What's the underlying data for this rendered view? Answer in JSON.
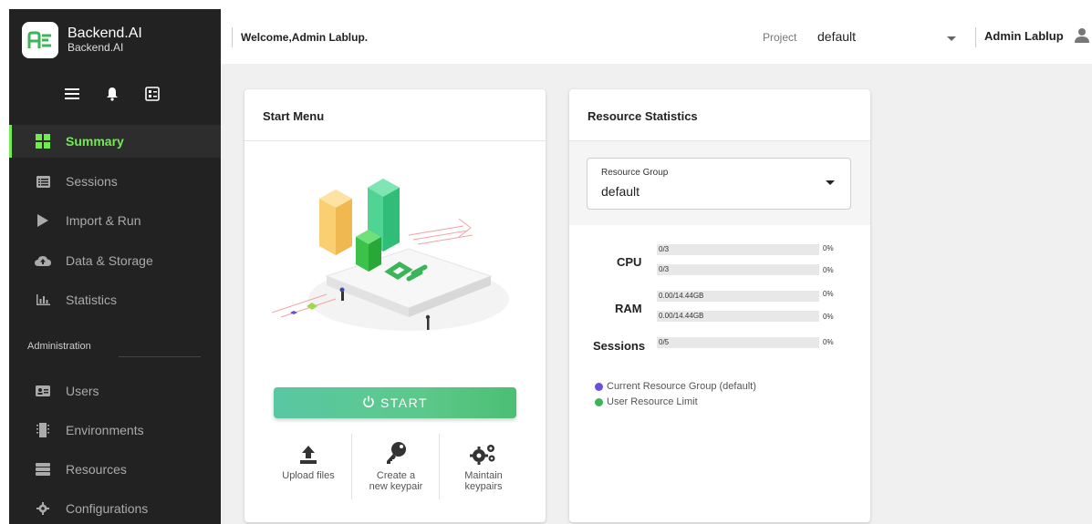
{
  "brand": {
    "title": "Backend.AI",
    "subtitle": "Backend.AI",
    "accent": "#72eb51"
  },
  "toolbar": {
    "icons": [
      "menu-icon",
      "bell-icon",
      "dashboard-icon"
    ]
  },
  "sidebar": {
    "items": [
      {
        "label": "Summary",
        "icon": "summary-grid-icon",
        "active": true
      },
      {
        "label": "Sessions",
        "icon": "sessions-list-icon"
      },
      {
        "label": "Import & Run",
        "icon": "play-icon"
      },
      {
        "label": "Data & Storage",
        "icon": "cloud-upload-icon"
      },
      {
        "label": "Statistics",
        "icon": "bar-chart-icon"
      }
    ],
    "admin_label": "Administration",
    "admin_items": [
      {
        "label": "Users",
        "icon": "id-card-icon"
      },
      {
        "label": "Environments",
        "icon": "chip-icon"
      },
      {
        "label": "Resources",
        "icon": "server-icon"
      },
      {
        "label": "Configurations",
        "icon": "gear-icon"
      }
    ]
  },
  "header": {
    "welcome": "Welcome,Admin Lablup.",
    "project_label": "Project",
    "project_value": "default",
    "user_name": "Admin Lablup"
  },
  "start_menu": {
    "title": "Start Menu",
    "start_label": "START",
    "actions": [
      {
        "line1": "Upload files",
        "line2": "",
        "icon": "upload-icon"
      },
      {
        "line1": "Create a",
        "line2": "new keypair",
        "icon": "key-icon"
      },
      {
        "line1": "Maintain",
        "line2": "keypairs",
        "icon": "gears-icon"
      }
    ]
  },
  "resource_stats": {
    "title": "Resource Statistics",
    "group_label": "Resource Group",
    "group_value": "default",
    "rows": {
      "cpu": {
        "name": "CPU",
        "bar1": "0/3",
        "pct1": "0%",
        "bar2": "0/3",
        "pct2": "0%"
      },
      "ram": {
        "name": "RAM",
        "bar1": "0.00/14.44GB",
        "pct1": "0%",
        "bar2": "0.00/14.44GB",
        "pct2": "0%"
      },
      "sessions": {
        "name": "Sessions",
        "bar1": "0/5",
        "pct1": "0%"
      }
    },
    "legend": [
      {
        "label": "Current Resource Group (default)",
        "color": "#6b4fd8"
      },
      {
        "label": "User Resource Limit",
        "color": "#3cb55a"
      }
    ]
  }
}
